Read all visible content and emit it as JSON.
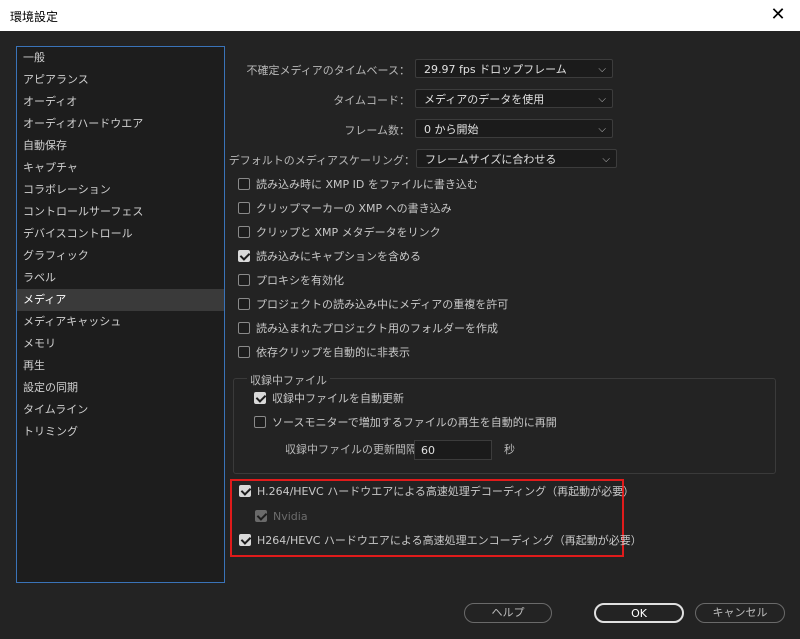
{
  "window": {
    "title": "環境設定",
    "close_glyph": "✕"
  },
  "sidebar": {
    "items": [
      {
        "label": "一般"
      },
      {
        "label": "アピアランス"
      },
      {
        "label": "オーディオ"
      },
      {
        "label": "オーディオハードウエア"
      },
      {
        "label": "自動保存"
      },
      {
        "label": "キャプチャ"
      },
      {
        "label": "コラボレーション"
      },
      {
        "label": "コントロールサーフェス"
      },
      {
        "label": "デバイスコントロール"
      },
      {
        "label": "グラフィック"
      },
      {
        "label": "ラベル"
      },
      {
        "label": "メディア",
        "selected": true
      },
      {
        "label": "メディアキャッシュ"
      },
      {
        "label": "メモリ"
      },
      {
        "label": "再生"
      },
      {
        "label": "設定の同期"
      },
      {
        "label": "タイムライン"
      },
      {
        "label": "トリミング"
      }
    ]
  },
  "media": {
    "timebase": {
      "label": "不確定メディアのタイムベース：",
      "value": "29.97 fps ドロップフレーム"
    },
    "timecode": {
      "label": "タイムコード：",
      "value": "メディアのデータを使用"
    },
    "frame_count": {
      "label": "フレーム数：",
      "value": "0 から開始"
    },
    "scaling": {
      "label": "デフォルトのメディアスケーリング：",
      "value": "フレームサイズに合わせる"
    },
    "checks": [
      {
        "label": "読み込み時に XMP ID をファイルに書き込む",
        "checked": false
      },
      {
        "label": "クリップマーカーの XMP への書き込み",
        "checked": false
      },
      {
        "label": "クリップと XMP メタデータをリンク",
        "checked": false
      },
      {
        "label": "読み込みにキャプションを含める",
        "checked": true
      },
      {
        "label": "プロキシを有効化",
        "checked": false
      },
      {
        "label": "プロジェクトの読み込み中にメディアの重複を許可",
        "checked": false
      },
      {
        "label": "読み込まれたプロジェクト用のフォルダーを作成",
        "checked": false
      },
      {
        "label": "依存クリップを自動的に非表示",
        "checked": false
      }
    ],
    "growing": {
      "title": "収録中ファイル",
      "auto_refresh": {
        "label": "収録中ファイルを自動更新",
        "checked": true
      },
      "auto_resume": {
        "label": "ソースモニターで増加するファイルの再生を自動的に再開",
        "checked": false
      },
      "interval_label": "収録中ファイルの更新間隔",
      "interval_value": "60",
      "interval_unit": "秒"
    },
    "hw_decode": {
      "label": "H.264/HEVC ハードウエアによる高速処理デコーディング（再起動が必要）",
      "checked": true
    },
    "nvidia": {
      "label": "Nvidia",
      "checked": true,
      "disabled": true
    },
    "hw_encode": {
      "label": "H264/HEVC ハードウエアによる高速処理エンコーディング（再起動が必要）",
      "checked": true
    }
  },
  "buttons": {
    "help": "ヘルプ",
    "ok": "OK",
    "cancel": "キャンセル"
  },
  "colors": {
    "background": "#232323",
    "highlight": "#e01b1b",
    "selection_border": "#3a73b8"
  }
}
